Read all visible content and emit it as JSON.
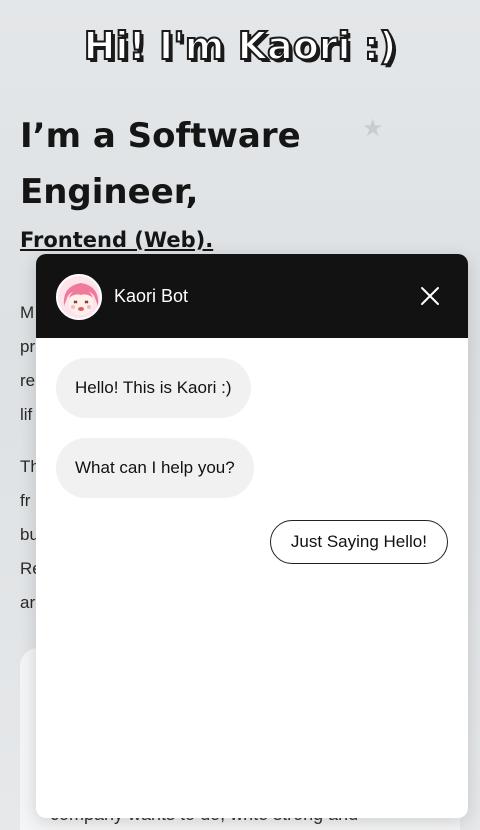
{
  "hero": {
    "title": "Hi! I'm Kaori :)"
  },
  "intro": {
    "headline_line1": "I’m a Software",
    "headline_line2": "Engineer,",
    "subheadline": "Frontend (Web).",
    "para1_lines": [
      "M",
      "pr",
      "re",
      "lif"
    ],
    "para2_lines": [
      "Th",
      "fr",
      "bu",
      "Re",
      "ar"
    ],
    "card_text": "company wants to do, write strong and"
  },
  "chat": {
    "header_title": "Kaori Bot",
    "messages": [
      {
        "from": "bot",
        "text": "Hello! This is Kaori :)"
      },
      {
        "from": "bot",
        "text": "What can I help you?"
      }
    ],
    "quick_reply": "Just Saying Hello!"
  },
  "icons": {
    "close": "close-icon",
    "avatar": "kaori-avatar",
    "star": "star-icon"
  },
  "colors": {
    "header_bg": "#121212",
    "bubble_bg": "#f1f1f2",
    "page_bg": "#e4e7e9"
  }
}
